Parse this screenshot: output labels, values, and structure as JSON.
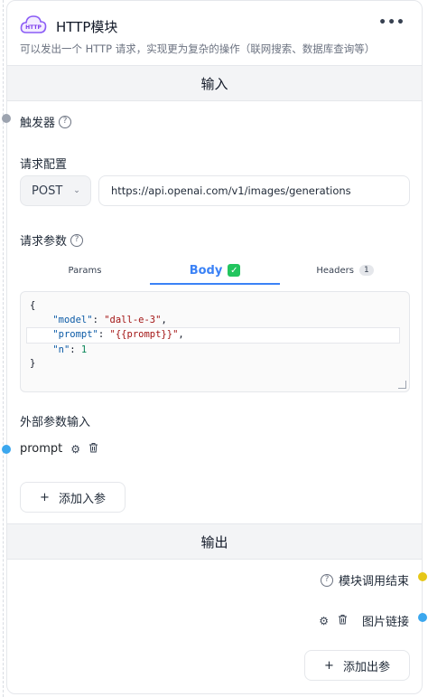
{
  "module": {
    "title": "HTTP模块",
    "icon_text": "HTTP",
    "description": "可以发出一个 HTTP 请求，实现更为复杂的操作（联网搜索、数据库查询等）",
    "more_icon": "more-icon"
  },
  "sections": {
    "input": "输入",
    "output": "输出"
  },
  "trigger": {
    "label": "触发器"
  },
  "request_config": {
    "label": "请求配置",
    "method": "POST",
    "url": "https://api.openai.com/v1/images/generations"
  },
  "request_params": {
    "label": "请求参数",
    "tabs": [
      {
        "label": "Params"
      },
      {
        "label": "Body"
      },
      {
        "label": "Headers",
        "count": "1"
      }
    ],
    "body_lines": {
      "open": "{",
      "model_key": "\"model\"",
      "model_val": "\"dall-e-3\"",
      "prompt_key": "\"prompt\"",
      "prompt_val": "\"{{prompt}}\"",
      "n_key": "\"n\"",
      "n_val": "1",
      "close": "}"
    }
  },
  "external_params": {
    "label": "外部参数输入",
    "items": [
      {
        "name": "prompt"
      }
    ],
    "add_label": "添加入参"
  },
  "outputs": {
    "end_label": "模块调用结束",
    "items": [
      {
        "name": "图片链接"
      }
    ],
    "add_label": "添加出参"
  },
  "colors": {
    "accent": "#3b82f6",
    "handle_blue": "#3ba7ee",
    "handle_gray": "#9ca3af",
    "handle_yellow": "#e6c718",
    "check_green": "#22c55e"
  }
}
